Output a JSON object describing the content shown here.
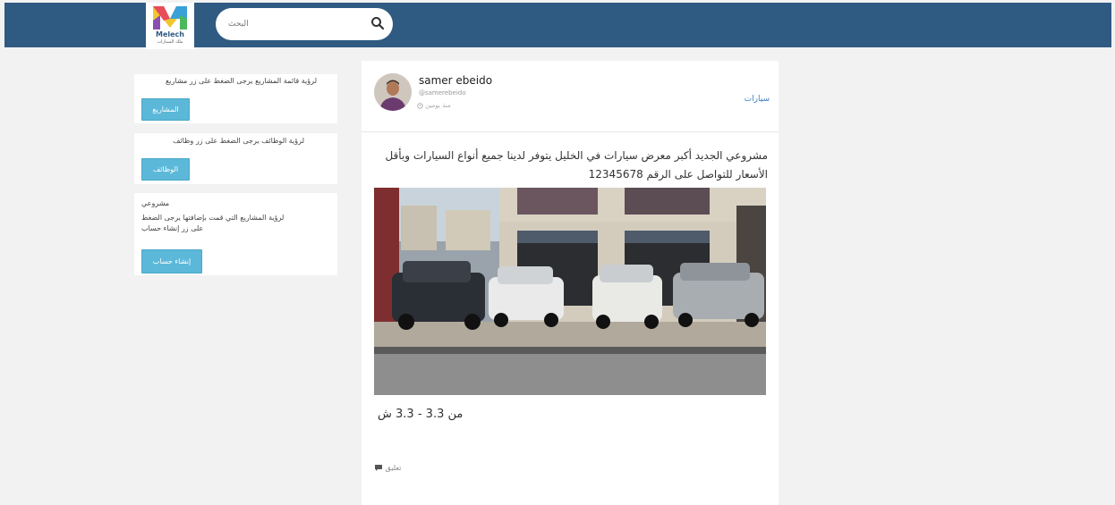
{
  "header": {
    "logo_text": "Melech",
    "logo_sub": "ملك السيارات",
    "search_placeholder": "البحث"
  },
  "sidebar": {
    "cards": [
      {
        "text": "لرؤية قائمة المشاريع يرجى الضغط على زر مشاريع",
        "button": "المشاريع"
      },
      {
        "text": "لرؤية الوظائف يرجى الضغط على زر وظائف",
        "button": "الوظائف"
      },
      {
        "title": "مشروعي",
        "text": "لرؤية المشاريع التي قمت بإضافتها يرجى الضغط على زر إنشاء حساب",
        "button": "إنشاء حساب"
      }
    ]
  },
  "post": {
    "author": "samer ebeido",
    "handle": "@samerebeido",
    "time": "منذ يومين",
    "category": "سيارات",
    "text": "مشروعي الجديد أكبر معرض سيارات في الخليل يتوفر لدينا جميع أنواع السيارات وبأقل الأسعار للتواصل على الرقم 12345678",
    "note": "من 3.3 - 3.3 ش",
    "comments": "تعليق"
  },
  "colors": {
    "header_bg": "#2f5a82",
    "button_bg": "#5bb8d8",
    "link": "#3a7bbf",
    "page_bg": "#f2f2f2"
  }
}
